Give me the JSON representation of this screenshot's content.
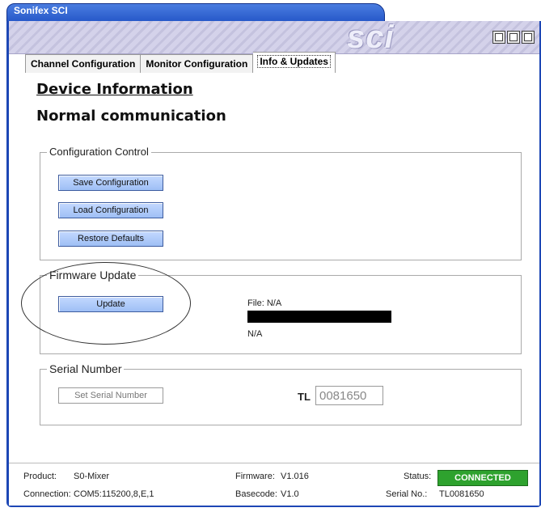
{
  "window": {
    "title": "Sonifex SCI",
    "logo": "sci"
  },
  "tabs": [
    {
      "label": "Channel Configuration"
    },
    {
      "label": "Monitor Configuration"
    },
    {
      "label": "Info & Updates",
      "active": true
    }
  ],
  "device": {
    "heading": "Device Information",
    "status_text": "Normal communication"
  },
  "config_control": {
    "title": "Configuration Control",
    "save_label": "Save Configuration",
    "load_label": "Load Configuration",
    "restore_label": "Restore Defaults"
  },
  "firmware": {
    "title": "Firmware Update",
    "update_label": "Update",
    "file_text": "File: N/A",
    "progress_text": "N/A"
  },
  "serial": {
    "title": "Serial Number",
    "set_label": "Set Serial Number",
    "prefix": "TL",
    "value": "0081650"
  },
  "statusbar": {
    "product_label": "Product:",
    "product_value": "S0-Mixer",
    "connection_label": "Connection:",
    "connection_value": "COM5:115200,8,E,1",
    "firmware_label": "Firmware:",
    "firmware_value": "V1.016",
    "basecode_label": "Basecode:",
    "basecode_value": "V1.0",
    "status_label": "Status:",
    "status_value": "CONNECTED",
    "serial_label": "Serial No.:",
    "serial_value": "TL0081650"
  },
  "colors": {
    "titlebar": "#1f50c4",
    "button": "#a9c7f7",
    "connected": "#2ea22e"
  }
}
